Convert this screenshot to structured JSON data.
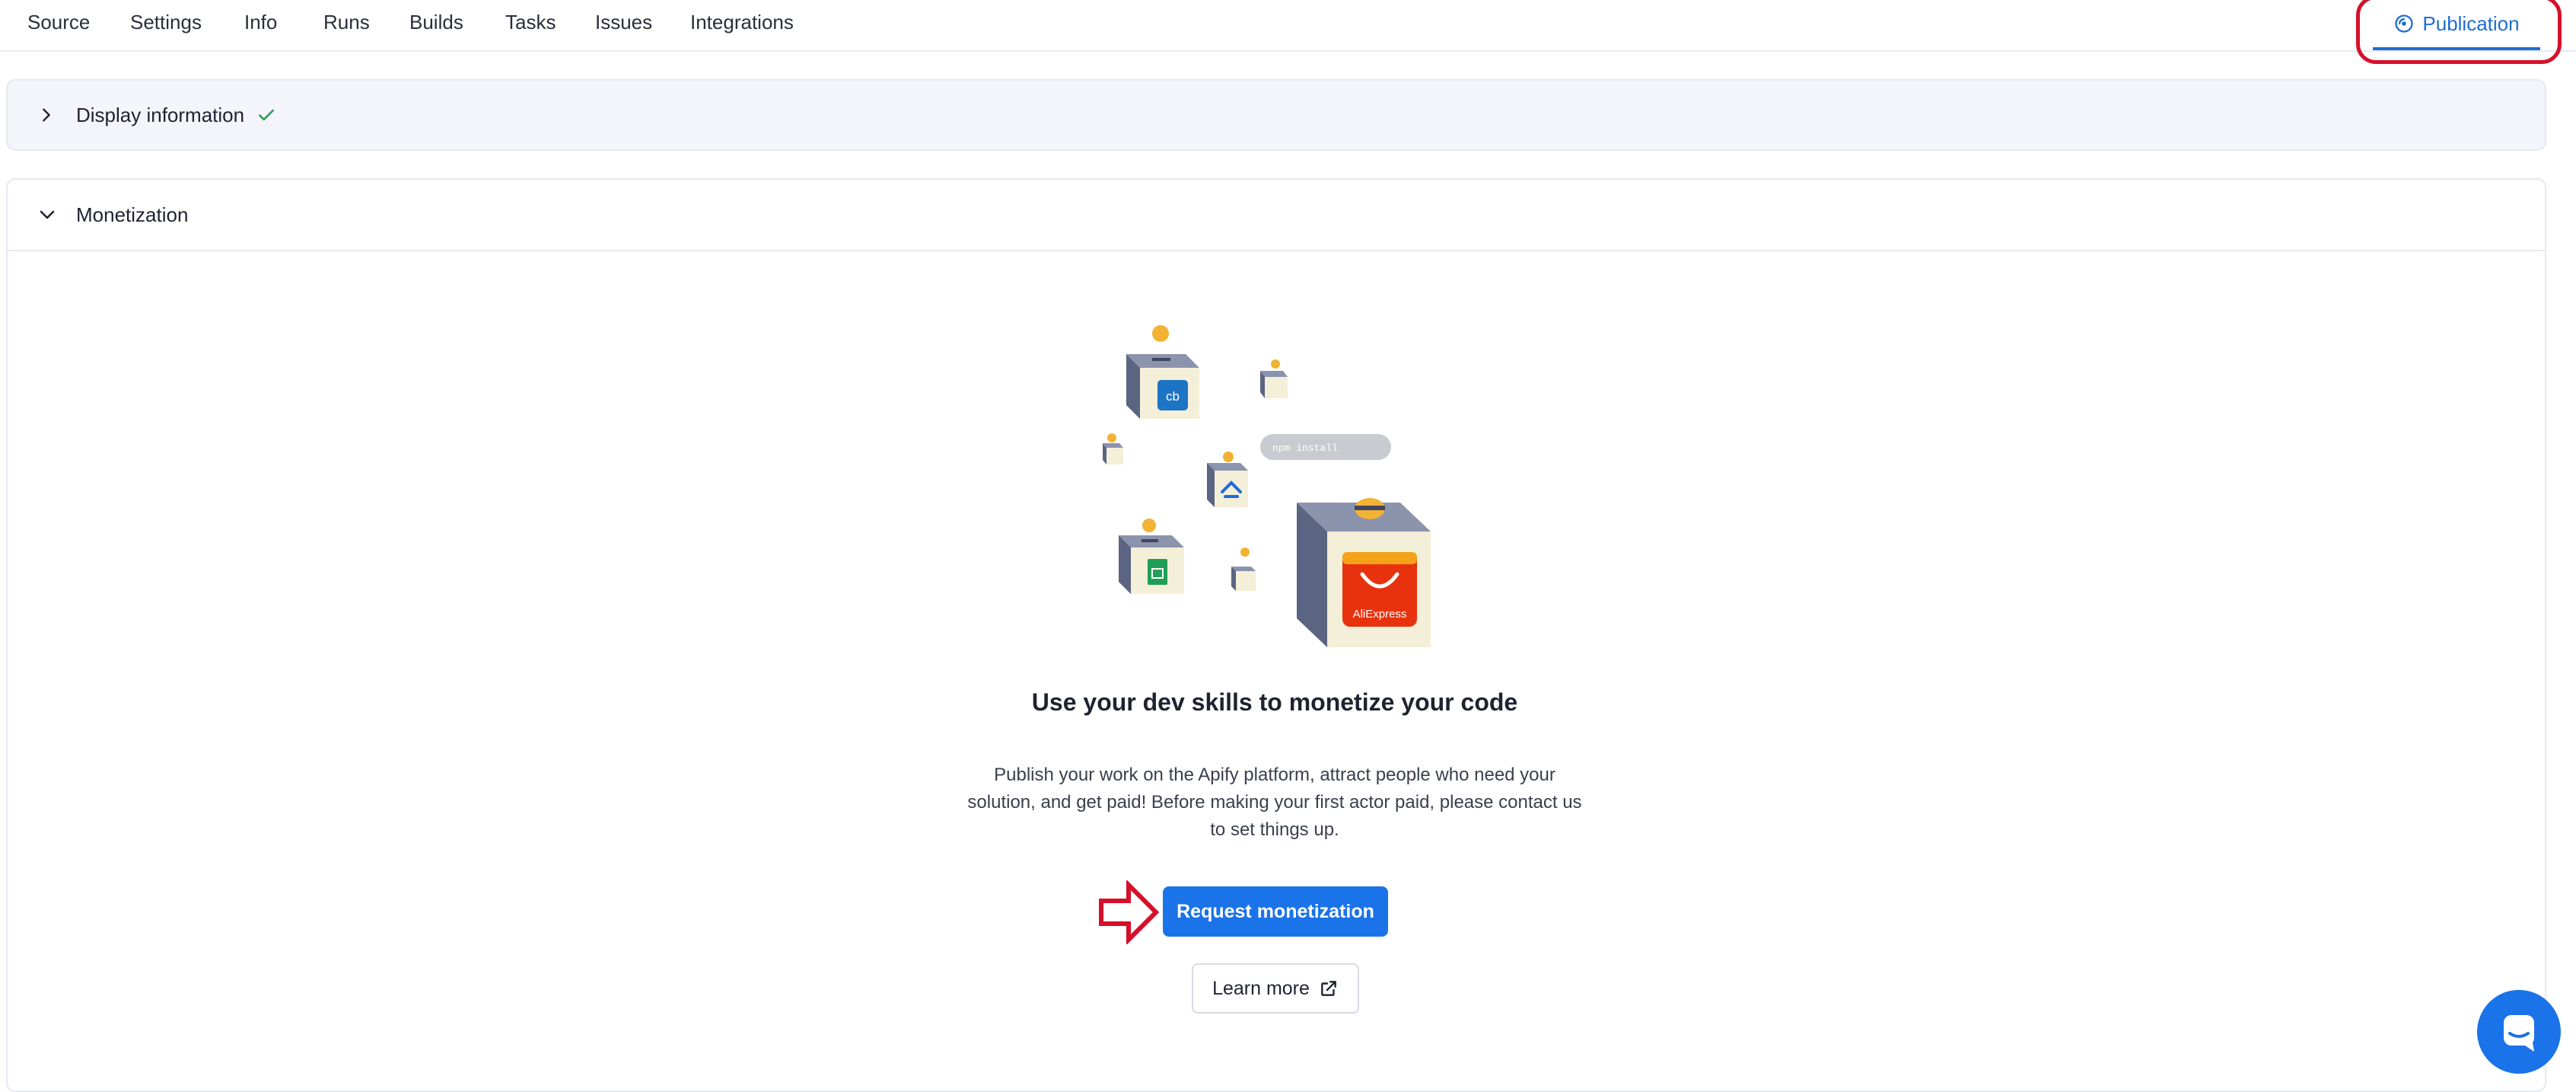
{
  "tabs": [
    {
      "label": "Source"
    },
    {
      "label": "Settings"
    },
    {
      "label": "Info"
    },
    {
      "label": "Runs"
    },
    {
      "label": "Builds"
    },
    {
      "label": "Tasks"
    },
    {
      "label": "Issues"
    },
    {
      "label": "Integrations"
    }
  ],
  "publication_tab": {
    "label": "Publication",
    "icon": "publication-icon",
    "active": true
  },
  "display_section": {
    "title": "Display information",
    "state": "collapsed",
    "status_icon": "check-icon"
  },
  "monetization_section": {
    "title": "Monetization",
    "state": "expanded"
  },
  "content": {
    "illustration_labels": {
      "cb": "cb",
      "aliexpress": "AliExpress",
      "npm": "npm install"
    },
    "headline": "Use your dev skills to monetize your code",
    "description": "Publish your work on the Apify platform, attract people who need your solution, and get paid! Before making your first actor paid, please contact us to set things up.",
    "primary_button": "Request monetization",
    "secondary_button": "Learn more"
  },
  "colors": {
    "accent": "#1a73e8",
    "highlight": "#d6102a",
    "success": "#2e9e5b"
  }
}
